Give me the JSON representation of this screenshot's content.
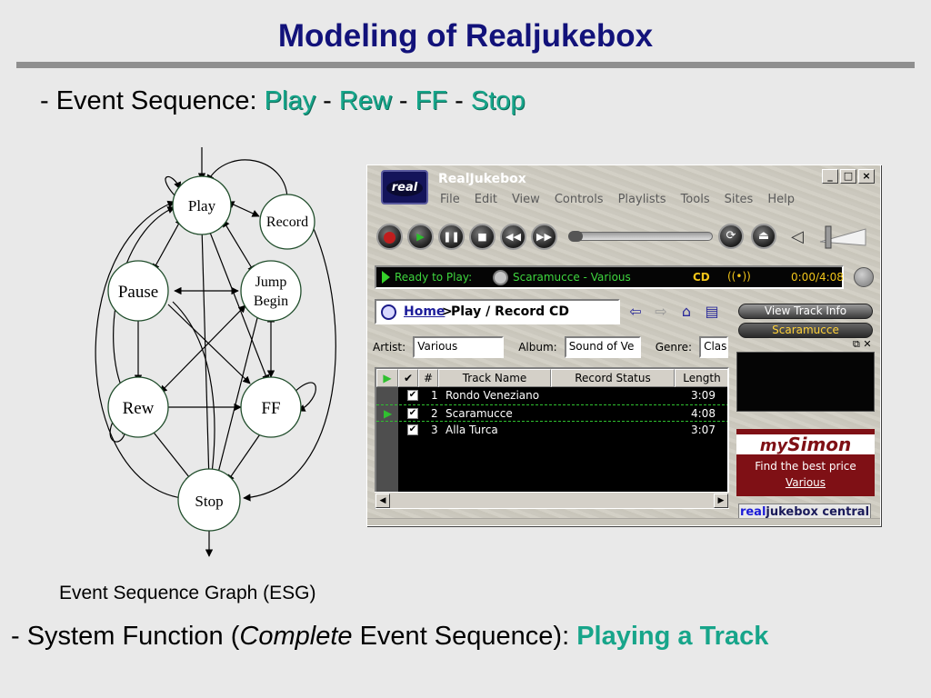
{
  "slide": {
    "title": "Modeling of Realjukebox",
    "sequence_prefix": "- Event Sequence: ",
    "sequence_events": [
      "Play",
      "Rew",
      "FF",
      "Stop"
    ],
    "sequence_sep": " - ",
    "sequence_trail": " - ",
    "esg_caption": "Event Sequence Graph (ESG)",
    "system_prefix": "- System Function (",
    "system_italic": "Complete",
    "system_middle": " Event Sequence): ",
    "system_function": "Playing a Track",
    "accent_color": "#17a58a",
    "title_color": "#12127a"
  },
  "esg": {
    "nodes": {
      "play": "Play",
      "record": "Record",
      "pause": "Pause",
      "jump_line1": "Jump",
      "jump_line2": "Begin",
      "rew": "Rew",
      "ff": "FF",
      "stop": "Stop"
    }
  },
  "jukebox": {
    "title": "RealJukebox",
    "logo": "real",
    "window_buttons": [
      "_",
      "□",
      "×"
    ],
    "menu": [
      "File",
      "Edit",
      "View",
      "Controls",
      "Playlists",
      "Tools",
      "Sites",
      "Help"
    ],
    "status_text": "Ready to Play:",
    "status_track": "Scaramucce - Various",
    "status_source": "CD",
    "status_radio": "((•))",
    "status_time": "0:00/4:08",
    "nav_home": "Home",
    "nav_sep": ">",
    "nav_page": "Play / Record CD",
    "artist_label": "Artist:",
    "artist_value": "Various",
    "album_label": "Album:",
    "album_value": "Sound of Ve",
    "genre_label": "Genre:",
    "genre_value": "Clas",
    "columns": [
      "#",
      "Track Name",
      "Record Status",
      "Length"
    ],
    "tracks": [
      {
        "num": "1",
        "name": "Rondo Veneziano",
        "length": "3:09"
      },
      {
        "num": "2",
        "name": "Scaramucce",
        "length": "4:08"
      },
      {
        "num": "3",
        "name": "Alla Turca",
        "length": "3:07"
      }
    ],
    "view_track_info": "View Track Info",
    "current_track": "Scaramucce",
    "ad_logo_prefix": "my",
    "ad_logo_suffix": "Simon",
    "ad_tagline": "Find the best price",
    "ad_link": "Various",
    "central_prefix": "real",
    "central_suffix": "jukebox central"
  }
}
